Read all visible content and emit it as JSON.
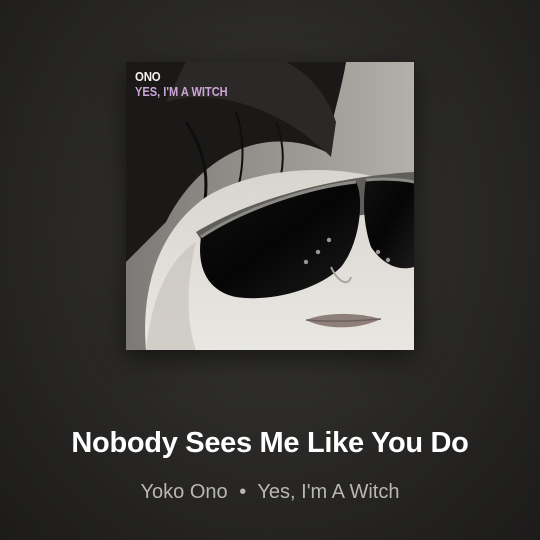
{
  "now_playing": {
    "cover": {
      "artist_text": "ONO",
      "album_text": "YES, I'M A WITCH",
      "accent_color": "#cda5d8"
    },
    "title": "Nobody Sees Me Like You Do",
    "artist": "Yoko Ono",
    "separator": "•",
    "album": "Yes, I'm A Witch"
  }
}
